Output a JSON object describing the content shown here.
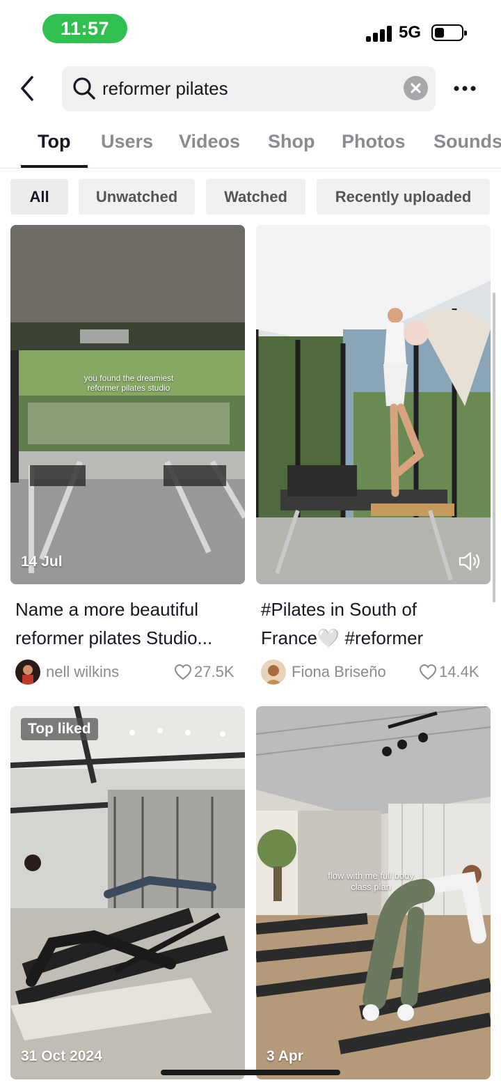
{
  "status_bar": {
    "time": "11:57",
    "network": "5G",
    "battery_level": 0.35
  },
  "search": {
    "query": "reformer pilates"
  },
  "tabs": [
    {
      "label": "Top",
      "active": true
    },
    {
      "label": "Users"
    },
    {
      "label": "Videos"
    },
    {
      "label": "Shop"
    },
    {
      "label": "Photos"
    },
    {
      "label": "Sounds"
    }
  ],
  "filters": [
    {
      "label": "All",
      "active": true
    },
    {
      "label": "Unwatched"
    },
    {
      "label": "Watched"
    },
    {
      "label": "Recently uploaded"
    }
  ],
  "results": [
    {
      "date": "14 Jul",
      "overlay_text": "you found the dreamiest reformer pilates studio",
      "title_line1": "Name a more beautiful",
      "title_line2": "reformer pilates Studio...",
      "author": "nell wilkins",
      "likes": "27.5K"
    },
    {
      "date": "",
      "has_sound_icon": true,
      "title_line1": "#Pilates in South of",
      "title_line2": "France🤍 #reformer",
      "author": "Fiona Briseño",
      "likes": "14.4K"
    },
    {
      "badge": "Top liked",
      "date": "31 Oct 2024"
    },
    {
      "date": "3 Apr",
      "overlay_text": "flow with me full body class plan"
    }
  ],
  "colors": {
    "status_green": "#30c04f",
    "text": "#161823",
    "muted": "#8a8b91",
    "chip_bg": "#f1f1f2"
  }
}
